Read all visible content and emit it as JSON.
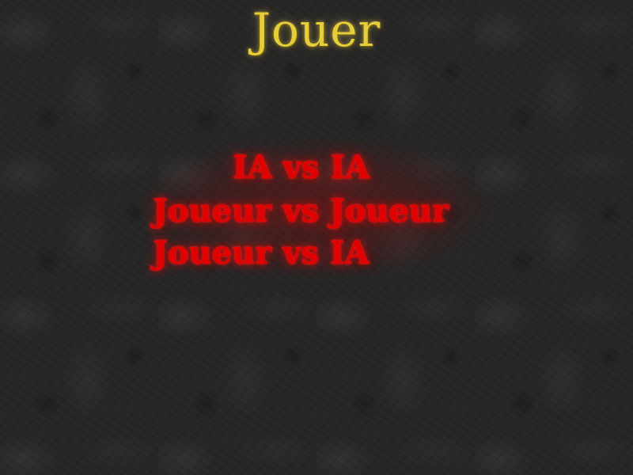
{
  "title": "Jouer",
  "menu": {
    "items": [
      {
        "label": "IA vs IA"
      },
      {
        "label": "Joueur vs Joueur"
      },
      {
        "label": "Joueur vs IA"
      }
    ]
  },
  "colors": {
    "title": "#e6cd3a",
    "menu_text": "#e10000",
    "background": "#262626"
  }
}
